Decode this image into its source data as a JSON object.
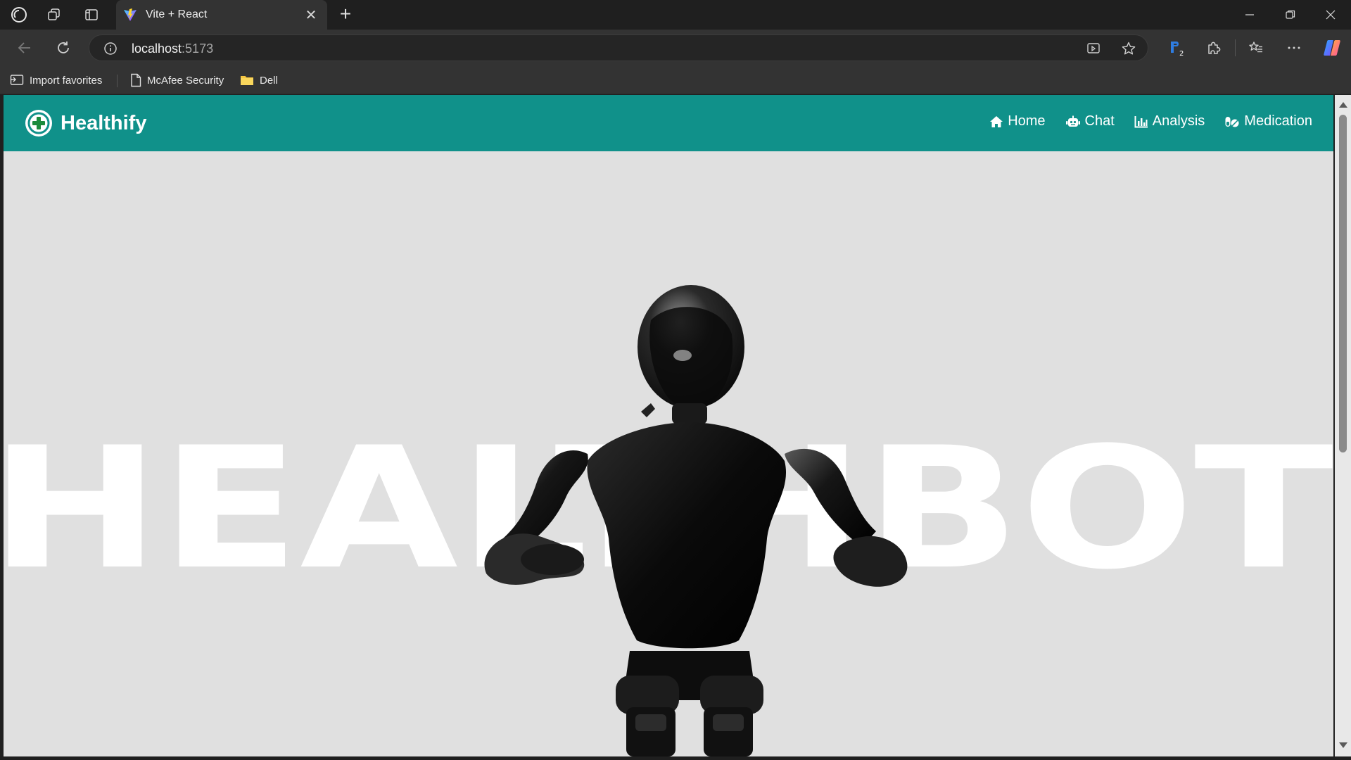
{
  "tab": {
    "title": "Vite + React"
  },
  "address": {
    "host": "localhost",
    "port": ":5173"
  },
  "favorites": [
    {
      "label": "Import favorites",
      "icon": "import-icon"
    },
    {
      "label": "McAfee Security",
      "icon": "page-icon"
    },
    {
      "label": "Dell",
      "icon": "folder-icon"
    }
  ],
  "extension_badge": "2",
  "app": {
    "brand": "Healthify",
    "nav": [
      {
        "label": "Home",
        "icon": "home-icon"
      },
      {
        "label": "Chat",
        "icon": "robot-icon"
      },
      {
        "label": "Analysis",
        "icon": "bar-chart-icon"
      },
      {
        "label": "Medication",
        "icon": "pills-icon"
      }
    ],
    "hero_word": "HEALTHBOT"
  },
  "colors": {
    "nav_bg": "#10918a",
    "page_bg": "#e0e0e0",
    "browser_dark": "#1f1f1f",
    "browser_mid": "#333333"
  }
}
